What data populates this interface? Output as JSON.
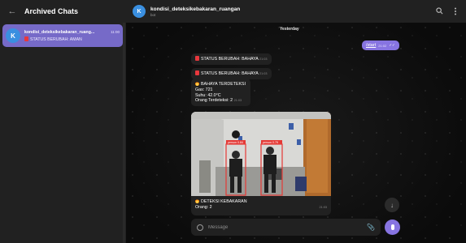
{
  "sidebar": {
    "title": "Archived Chats",
    "back_icon": "arrow-left-icon",
    "chat": {
      "avatar_letter": "K",
      "name": "kondisi_deteksikebakaran_ruang...",
      "time": "11:00",
      "preview": "STATUS BERUBAH: AMAN",
      "preview_icon": "red-square-icon",
      "accent": "#766ac8"
    }
  },
  "header": {
    "avatar_letter": "K",
    "title": "kondisi_deteksikebakaran_ruangan",
    "subtitle": "bot",
    "icons": [
      "search-icon",
      "more-vertical-icon"
    ]
  },
  "chat": {
    "date_label": "Yesterday",
    "outgoing": {
      "text": "/start",
      "time": "21:02"
    },
    "messages": [
      {
        "icon": "red-square-icon",
        "lines": [
          "STATUS BERUBAH: BAHAYA"
        ],
        "time": "21:03"
      },
      {
        "icon": "red-square-icon",
        "lines": [
          "STATUS BERUBAH: BAHAYA"
        ],
        "time": "21:03"
      },
      {
        "icon": "fire-icon",
        "lines": [
          "BAHAYA TERDETEKSI",
          "Gas: 721",
          "Suhu: 42.0°C",
          "Orang Terdeteksi: 2"
        ],
        "time": "21:03"
      }
    ],
    "photo": {
      "detections": [
        {
          "label": "person 0.84"
        },
        {
          "label": "person 0.79"
        }
      ],
      "caption_lines": [
        "DETEKSI KEBAKARAN",
        "Orang: 2"
      ],
      "caption_icon": "fire-icon",
      "time": "21:03"
    }
  },
  "composer": {
    "placeholder": "Message",
    "value": ""
  },
  "colors": {
    "accent": "#8774e1",
    "bubble": "#212121",
    "sidebar": "#212121",
    "background": "#0f0f0f",
    "detection_box": "#e53935"
  }
}
